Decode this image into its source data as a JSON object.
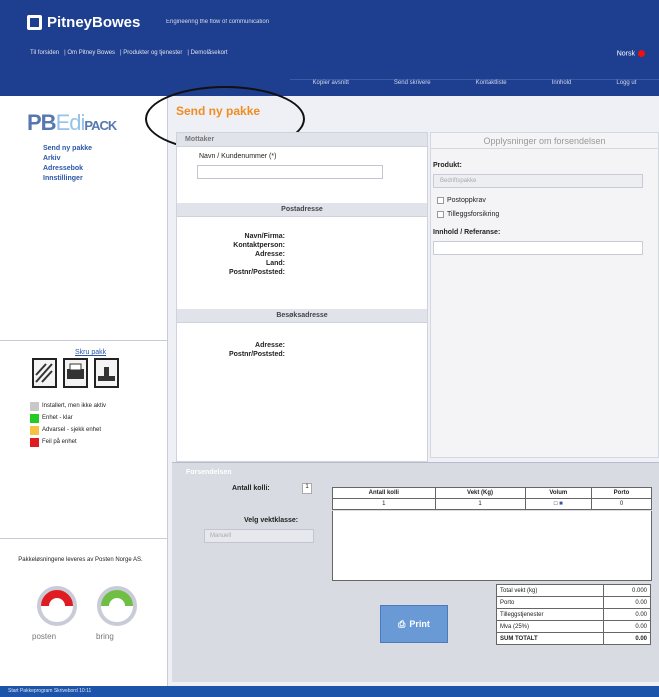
{
  "header": {
    "brand": "PitneyBowes",
    "tagline": "Engineering the flow of communication",
    "nav": [
      "Til forsiden",
      "Om Pitney Bowes",
      "Produkter og tjenester",
      "Demolåsekort"
    ],
    "lang": "Norsk",
    "toolbar": [
      "Kopier avsnitt",
      "Send skrivere",
      "Kontaktliste",
      "Innhold",
      "Logg ut"
    ]
  },
  "sidebar": {
    "logo_pb": "PB",
    "logo_edi": "Edi",
    "logo_pack": "PACK",
    "menu": [
      "Send ny pakke",
      "Arkiv",
      "Adressebok",
      "Innstillinger"
    ],
    "device_link": "Skru pakk",
    "legend": [
      {
        "color": "#c8c8c8",
        "label": "Installert, men ikke aktiv"
      },
      {
        "color": "#22cc22",
        "label": "Enhet - klar"
      },
      {
        "color": "#f5c242",
        "label": "Advarsel - sjekk enhet"
      },
      {
        "color": "#e01c23",
        "label": "Feil på enhet"
      }
    ],
    "partner_text": "Pakkeløsningene leveres av Posten Norge AS.",
    "posten": "posten",
    "bring": "bring"
  },
  "page": {
    "title": "Send ny pakke"
  },
  "mottaker": {
    "header": "Mottaker",
    "kunde_label": "Navn / Kundenummer (*)",
    "postadresse": "Postadresse",
    "fields": [
      "Navn/Firma:",
      "Kontaktperson:",
      "Adresse:",
      "Land:",
      "Postnr/Poststed:"
    ],
    "besoksadresse": "Besøksadresse",
    "besok_fields": [
      "Adresse:",
      "Postnr/Poststed:"
    ]
  },
  "forsendelse": {
    "header": "Opplysninger om forsendelsen",
    "produkt_label": "Produkt:",
    "produkt_value": "Bedriftspakke",
    "options": [
      "Postoppkrav",
      "Tilleggsforsikring"
    ],
    "innhold_label": "Innhold / Referanse:"
  },
  "bottom": {
    "header": "Forsendelsen",
    "antall_label": "Antall kolli:",
    "antall_value": "1",
    "velg_label": "Velg vektklasse:",
    "velg_value": "Manuell",
    "table_headers": [
      "Antall kolli",
      "Vekt (Kg)",
      "Volum",
      "Porto"
    ],
    "row": [
      "1",
      "1",
      "",
      "0"
    ],
    "summary": [
      [
        "Total vekt (kg)",
        "0.000"
      ],
      [
        "Porto",
        "0.00"
      ],
      [
        "Tilleggstjenester",
        "0.00"
      ],
      [
        "Mva (25%)",
        "0.00"
      ],
      [
        "SUM TOTALT",
        "0.00"
      ]
    ],
    "print": "Print"
  },
  "taskbar": "Start  Pakkeprogram  Skrivebord  10:11"
}
